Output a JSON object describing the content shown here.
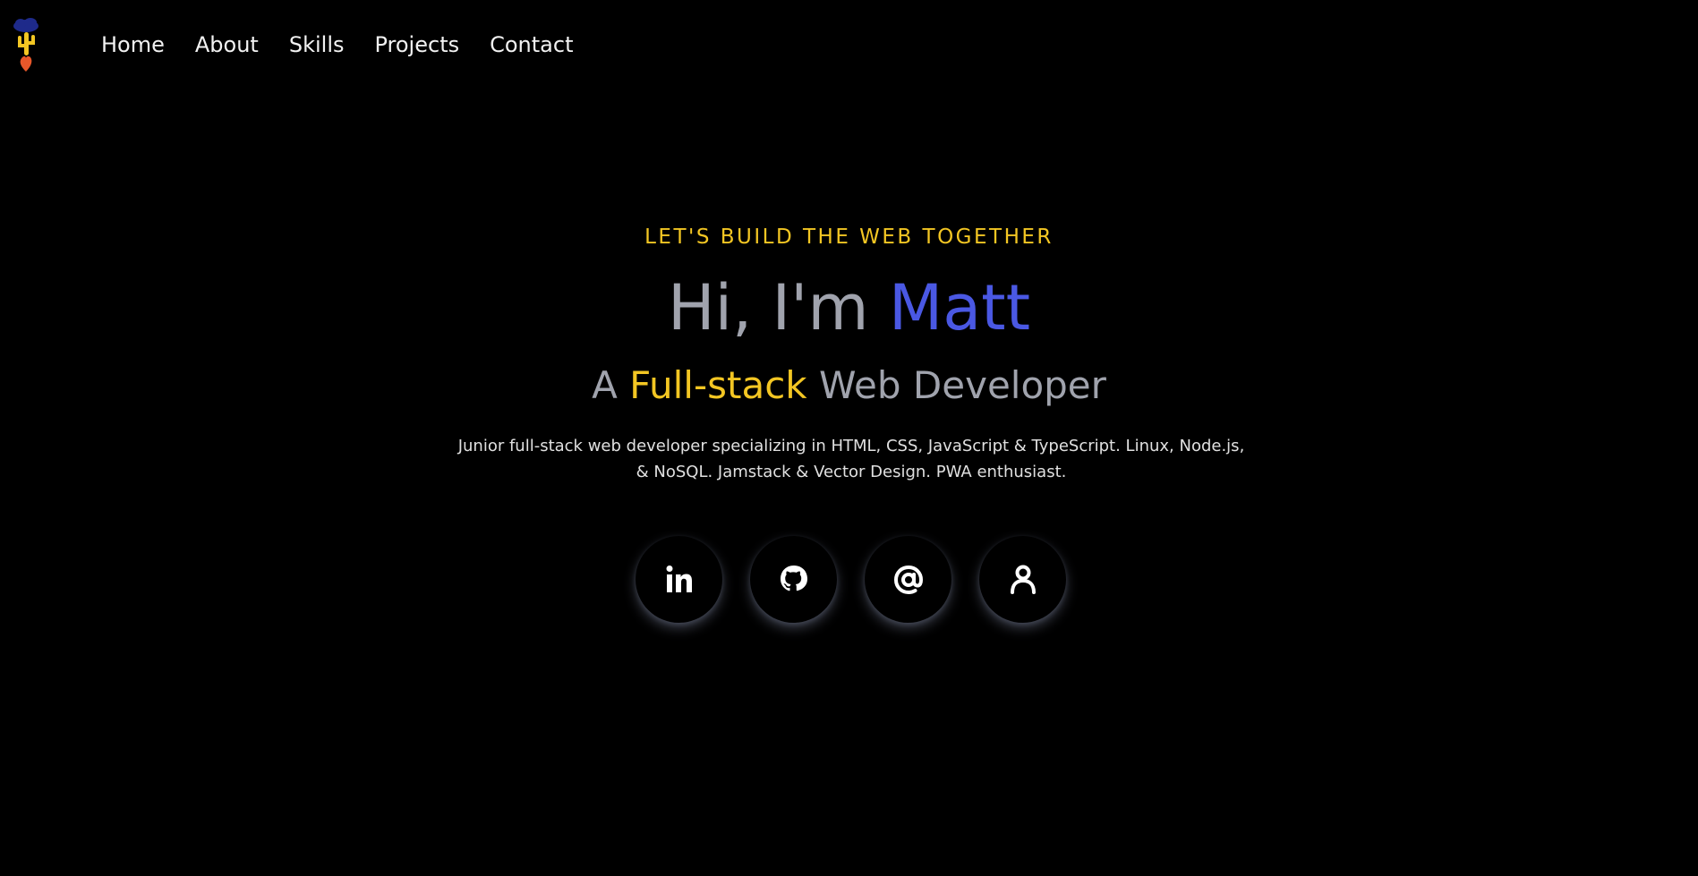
{
  "nav": {
    "links": [
      "Home",
      "About",
      "Skills",
      "Projects",
      "Contact"
    ]
  },
  "hero": {
    "tagline": "LET'S BUILD THE WEB TOGETHER",
    "greeting_prefix": "Hi, I'm ",
    "greeting_name": "Matt",
    "role_prefix": "A ",
    "role_accent": "Full-stack",
    "role_suffix": " Web Developer",
    "description": "Junior full-stack web developer specializing in HTML, CSS, JavaScript & TypeScript. Linux, Node.js, & NoSQL. Jamstack & Vector Design. PWA enthusiast."
  },
  "socials": [
    {
      "icon": "linkedin-icon"
    },
    {
      "icon": "github-icon"
    },
    {
      "icon": "email-at-icon"
    },
    {
      "icon": "profile-icon"
    }
  ],
  "colors": {
    "background": "#000000",
    "accent_yellow": "#f3c623",
    "accent_blue": "#4a58e3",
    "text_gray": "#a0a3ad"
  }
}
